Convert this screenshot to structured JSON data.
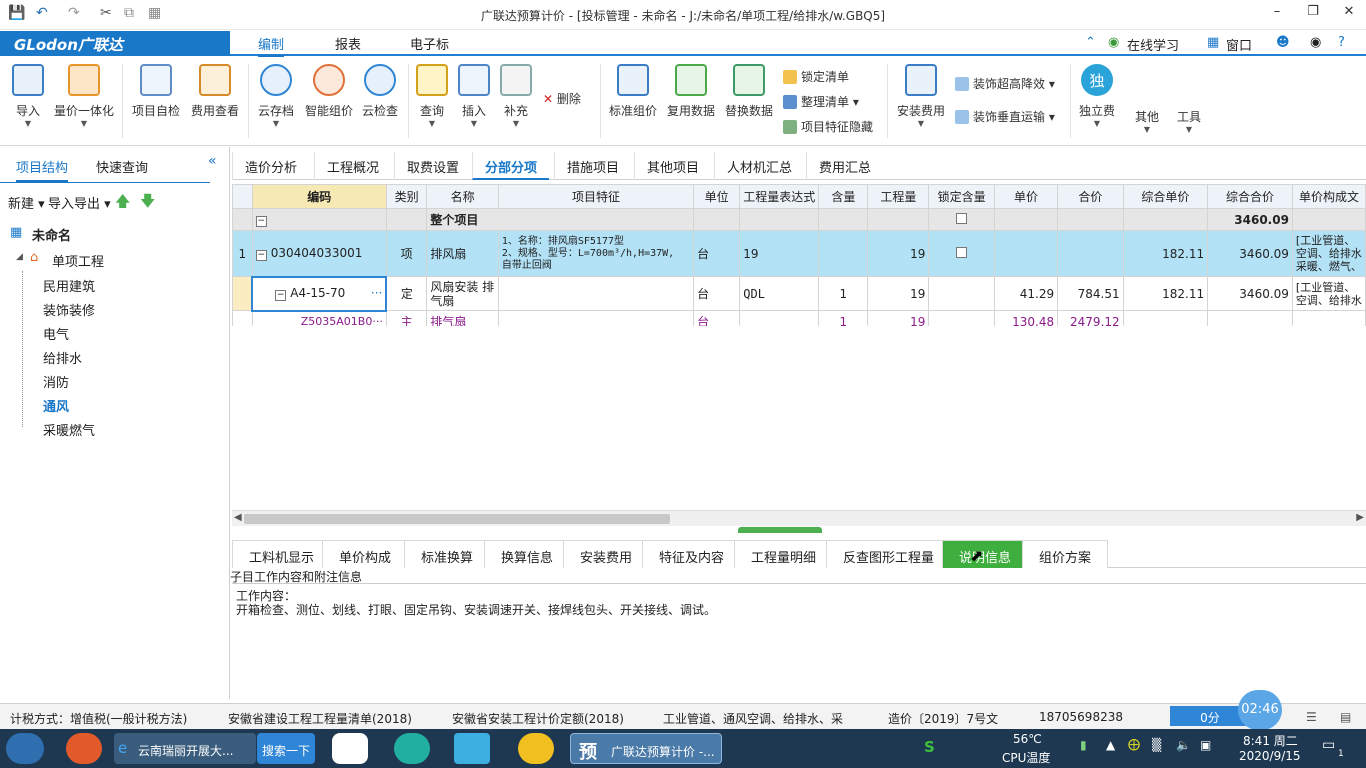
{
  "window": {
    "title": "广联达预算计价 - [投标管理 - 未命名 - J:/未命名/单项工程/给排水/w.GBQ5]"
  },
  "menubar": {
    "logo": "GLodon广联达",
    "items": [
      "编制",
      "报表",
      "电子标"
    ],
    "right": {
      "learn": "在线学习",
      "window": "窗口"
    }
  },
  "ribbon": {
    "buttons": [
      {
        "label": "导入",
        "icon": "import-icon"
      },
      {
        "label": "量价一体化",
        "icon": "quantity-price-icon"
      },
      {
        "label": "项目自检",
        "icon": "self-check-icon"
      },
      {
        "label": "费用查看",
        "icon": "cost-view-icon"
      },
      {
        "label": "云存档",
        "icon": "cloud-save-icon"
      },
      {
        "label": "智能组价",
        "icon": "smart-price-icon"
      },
      {
        "label": "云检查",
        "icon": "cloud-check-icon"
      },
      {
        "label": "查询",
        "icon": "query-icon"
      },
      {
        "label": "插入",
        "icon": "insert-icon"
      },
      {
        "label": "补充",
        "icon": "supplement-icon"
      },
      {
        "label": "标准组价",
        "icon": "standard-price-icon"
      },
      {
        "label": "复用数据",
        "icon": "reuse-data-icon"
      },
      {
        "label": "替换数据",
        "icon": "replace-data-icon"
      },
      {
        "label": "安装费用",
        "icon": "install-cost-icon"
      },
      {
        "label": "独立费",
        "icon": "independent-fee-icon"
      },
      {
        "label": "其他",
        "icon": ""
      },
      {
        "label": "工具",
        "icon": ""
      }
    ],
    "delete": "删除",
    "small": {
      "lock": "锁定清单",
      "organize": "整理清单",
      "hide": "项目特征隐藏",
      "super_high": "装饰超高降效",
      "vertical": "装饰垂直运输"
    },
    "independent_glyph": "独"
  },
  "leftpanel": {
    "tabs": [
      "项目结构",
      "快速查询"
    ],
    "toolbar": {
      "new": "新建",
      "io": "导入导出"
    },
    "root": "未命名",
    "project": "单项工程",
    "items": [
      "民用建筑",
      "装饰装修",
      "电气",
      "给排水",
      "消防",
      "通风",
      "采暖燃气"
    ],
    "selected": "通风"
  },
  "toptabs": [
    "造价分析",
    "工程概况",
    "取费设置",
    "分部分项",
    "措施项目",
    "其他项目",
    "人材机汇总",
    "费用汇总"
  ],
  "grid": {
    "columns": [
      "编码",
      "类别",
      "名称",
      "项目特征",
      "单位",
      "工程量表达式",
      "含量",
      "工程量",
      "锁定含量",
      "单价",
      "合价",
      "综合单价",
      "综合合价",
      "单价构成文"
    ],
    "whole": {
      "name": "整个项目",
      "total": "3460.09"
    },
    "rows": [
      {
        "no": "1",
        "code": "030404033001",
        "type": "项",
        "name": "排风扇",
        "feature_lines": [
          "1、名称：排风扇SF5177型",
          "2、规格、型号：L=700m³/h,H=37W,",
          "自带止回阀"
        ],
        "unit": "台",
        "expr": "19",
        "content": "",
        "qty": "19",
        "unit_price": "",
        "price": "",
        "comp_unit": "182.11",
        "comp_total": "3460.09",
        "build_lines": [
          "[工业管道、",
          "空调、给排水",
          "采暖、燃气、"
        ]
      },
      {
        "no": "",
        "code": "A4-15-70",
        "type": "定",
        "name": "风扇安装 排气扇",
        "feature_lines": [],
        "unit": "台",
        "expr": "QDL",
        "content": "1",
        "qty": "19",
        "unit_price": "41.29",
        "price": "784.51",
        "comp_unit": "182.11",
        "comp_total": "3460.09",
        "build_lines": [
          "[工业管道、",
          "空调、给排水"
        ]
      },
      {
        "no": "",
        "code": "Z5035A01B0···",
        "type": "主",
        "name": "排气扇",
        "feature_lines": [],
        "unit": "台",
        "expr": "",
        "content": "1",
        "qty": "19",
        "unit_price": "130.48",
        "price": "2479.12",
        "comp_unit": "",
        "comp_total": "",
        "build_lines": []
      }
    ]
  },
  "bottabs": [
    "工料机显示",
    "单价构成",
    "标准换算",
    "换算信息",
    "安装费用",
    "特征及内容",
    "工程量明细",
    "反查图形工程量",
    "说明信息",
    "组价方案"
  ],
  "bottabs_active": "说明信息",
  "info": {
    "header": "子目工作内容和附注信息",
    "label": "工作内容：",
    "text": "开箱检查、测位、划线、打眼、固定吊钩、安装调速开关、接焊线包头、开关接线、调试。"
  },
  "statusbar": {
    "tax": "计税方式：增值税(一般计税方法)",
    "list": "安徽省建设工程工程量清单(2018)",
    "quota": "安徽省安装工程计价定额(2018)",
    "spec": "工业管道、通风空调、给排水、采",
    "doc": "造价〔2019〕7号文",
    "phone": "18705698238",
    "score": "0分",
    "timer": "02:46"
  },
  "taskbar": {
    "ie": "云南瑞丽开展大...",
    "search": "搜索一下",
    "app": "广联达预算计价 -...",
    "temp": "56℃",
    "temp_label": "CPU温度",
    "time": "8:41 周二",
    "date": "2020/9/15",
    "badge": "1"
  },
  "colors": {
    "brand": "#1a78c8",
    "active_tab": "#3eae3e",
    "selected_row": "#b3e2f7"
  }
}
